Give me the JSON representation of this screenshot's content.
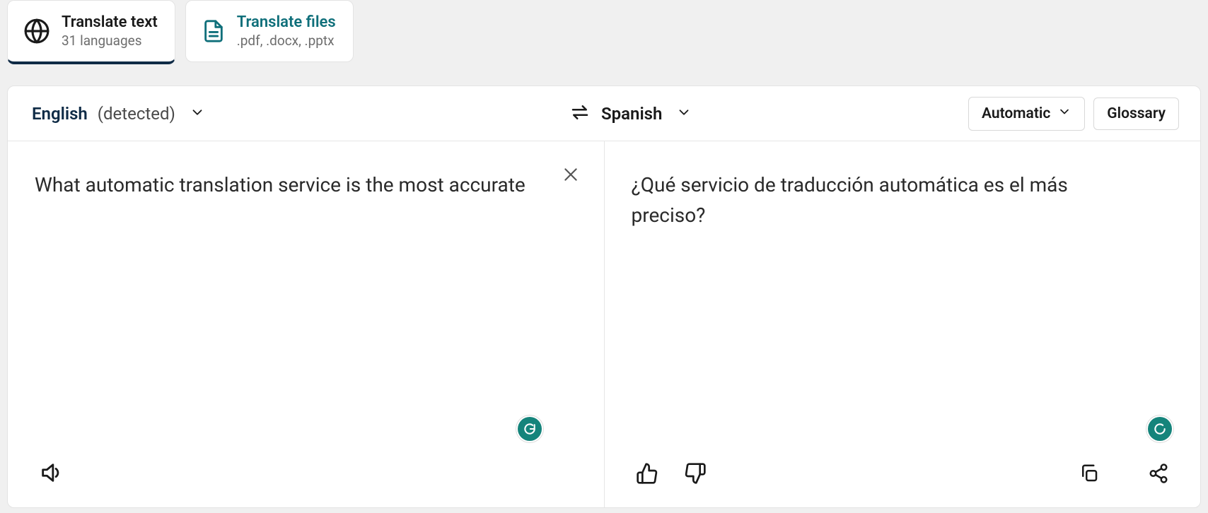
{
  "tabs": {
    "text": {
      "title": "Translate text",
      "subtitle": "31 languages"
    },
    "files": {
      "title": "Translate files",
      "subtitle": ".pdf, .docx, .pptx"
    }
  },
  "langbar": {
    "source_lang": "English",
    "detected_suffix": "(detected)",
    "target_lang": "Spanish",
    "formality_label": "Automatic",
    "glossary_label": "Glossary"
  },
  "panes": {
    "source_text": "What automatic translation service is the most accurate",
    "target_text": "¿Qué servicio de traducción automática es el más preciso?"
  }
}
